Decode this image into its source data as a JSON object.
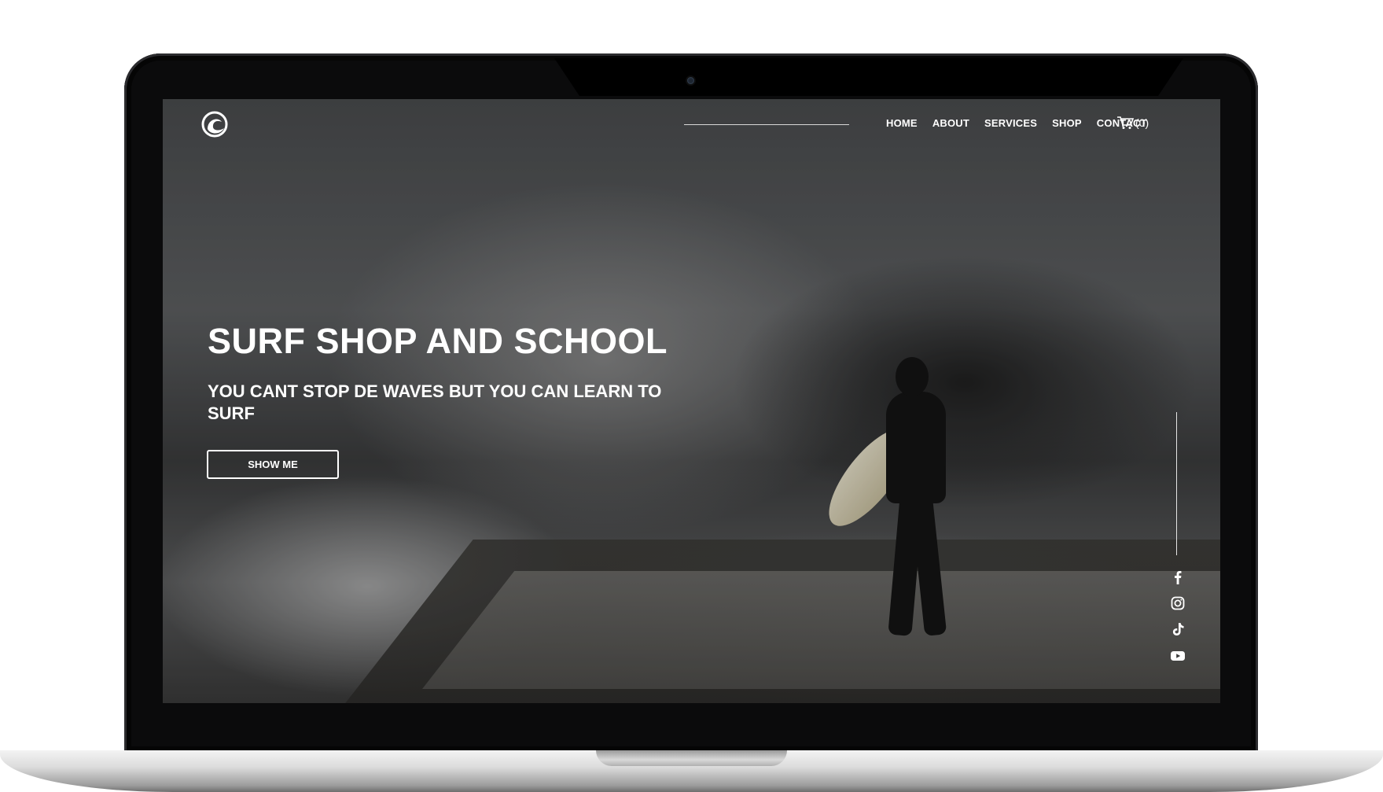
{
  "nav": {
    "items": [
      {
        "label": "HOME"
      },
      {
        "label": "ABOUT"
      },
      {
        "label": "SERVICES"
      },
      {
        "label": "SHOP"
      },
      {
        "label": "CONTACT"
      }
    ],
    "cart_count": "(0)"
  },
  "hero": {
    "title": "SURF SHOP AND SCHOOL",
    "subtitle": "YOU CANT STOP DE WAVES BUT YOU CAN LEARN TO SURF",
    "button_label": "SHOW ME"
  },
  "social": [
    {
      "icon": "facebook-icon"
    },
    {
      "icon": "instagram-icon"
    },
    {
      "icon": "tiktok-icon"
    },
    {
      "icon": "youtube-icon"
    }
  ],
  "colors": {
    "text": "#ffffff",
    "laptop_frame": "#0b0b0c",
    "screen_base": "#4a4c4e"
  }
}
